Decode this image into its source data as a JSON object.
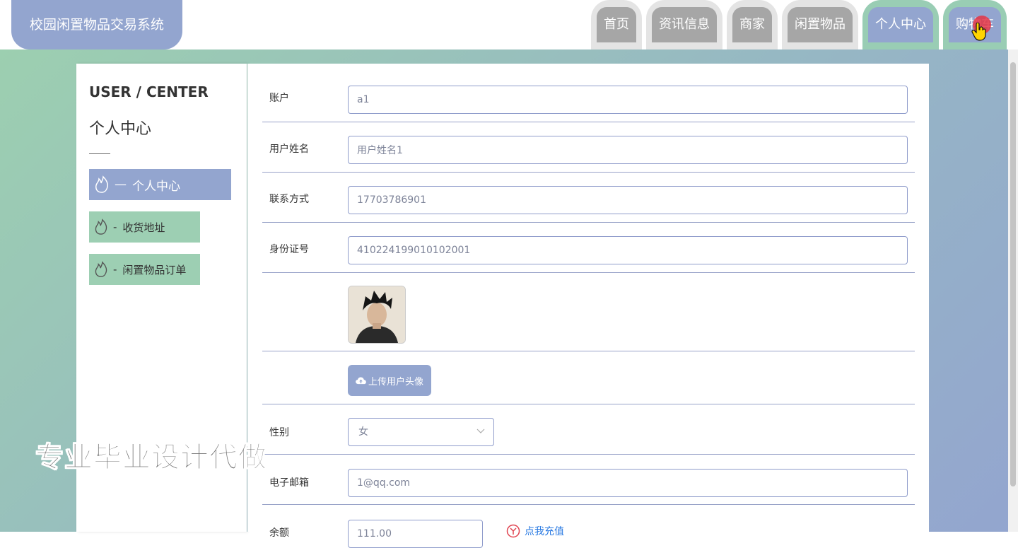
{
  "header": {
    "logo": "校园闲置物品交易系统",
    "nav": [
      "首页",
      "资讯信息",
      "商家",
      "闲置物品",
      "个人中心",
      "购物车"
    ]
  },
  "sidebar": {
    "title": "USER / CENTER",
    "subtitle": "个人中心",
    "items": [
      {
        "label": "个人中心",
        "active": true
      },
      {
        "label": "收货地址",
        "active": false
      },
      {
        "label": "闲置物品订单",
        "active": false
      }
    ]
  },
  "form": {
    "account": {
      "label": "账户",
      "value": "a1"
    },
    "username": {
      "label": "用户姓名",
      "value": "用户姓名1"
    },
    "phone": {
      "label": "联系方式",
      "value": "17703786901"
    },
    "idcard": {
      "label": "身份证号",
      "value": "410224199010102001"
    },
    "upload_label": "上传用户头像",
    "gender": {
      "label": "性别",
      "value": "女"
    },
    "email": {
      "label": "电子邮箱",
      "value": "1@qq.com"
    },
    "balance": {
      "label": "余额",
      "value": "111.00",
      "link": "点我充值"
    }
  },
  "watermark": "专业毕业设计代做",
  "colors": {
    "accent": "#93a5cf",
    "green": "#9dcfb3",
    "nav_gray": "#a6a6a6"
  }
}
